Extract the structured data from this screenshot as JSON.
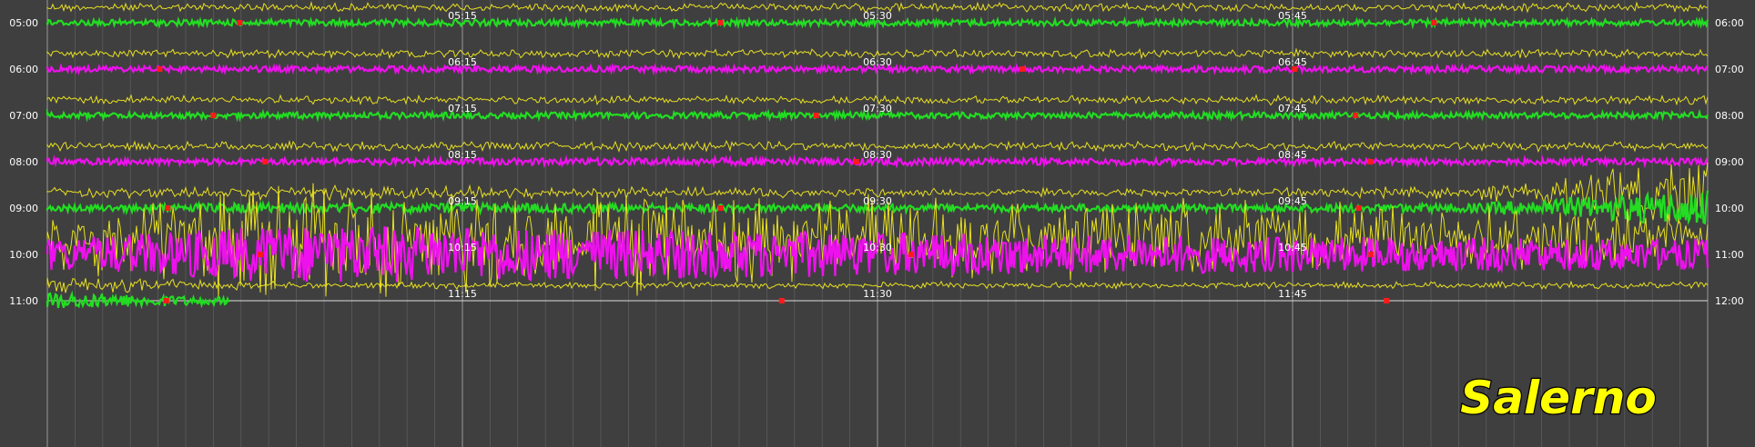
{
  "chart_data": {
    "type": "line",
    "title": "",
    "station_label": "Salerno",
    "rows": [
      {
        "left": "05:00",
        "right": "06:00",
        "color": "#22dd22",
        "ticks": [
          "05:15",
          "05:30",
          "05:45"
        ],
        "activity": [
          0.04,
          0.05,
          0.05,
          0.04,
          0.05,
          0.04,
          0.05,
          0.04
        ]
      },
      {
        "left": "06:00",
        "right": "07:00",
        "color": "#ee11ee",
        "ticks": [
          "06:15",
          "06:30",
          "06:45"
        ],
        "activity": [
          0.04,
          0.04,
          0.05,
          0.04,
          0.04,
          0.05,
          0.05,
          0.04
        ]
      },
      {
        "left": "07:00",
        "right": "08:00",
        "color": "#22dd22",
        "ticks": [
          "07:15",
          "07:30",
          "07:45"
        ],
        "activity": [
          0.04,
          0.05,
          0.04,
          0.05,
          0.04,
          0.05,
          0.04,
          0.05
        ]
      },
      {
        "left": "08:00",
        "right": "09:00",
        "color": "#ee11ee",
        "ticks": [
          "08:15",
          "08:30",
          "08:45"
        ],
        "activity": [
          0.05,
          0.05,
          0.06,
          0.08,
          0.06,
          0.05,
          0.06,
          0.05
        ]
      },
      {
        "left": "09:00",
        "right": "10:00",
        "color": "#22dd22",
        "ticks": [
          "09:15",
          "09:30",
          "09:45"
        ],
        "activity": [
          0.05,
          0.12,
          0.1,
          0.08,
          0.07,
          0.07,
          0.1,
          0.6
        ]
      },
      {
        "left": "10:00",
        "right": "11:00",
        "color": "#ee11ee",
        "ticks": [
          "10:15",
          "10:30",
          "10:45"
        ],
        "activity": [
          0.5,
          1.0,
          0.9,
          0.8,
          0.7,
          0.6,
          0.55,
          0.5
        ]
      },
      {
        "left": "11:00",
        "right": "12:00",
        "color": "#22dd22",
        "ticks": [
          "11:15",
          "11:30",
          "11:45"
        ],
        "activity": [
          0.25,
          0.0,
          0.0,
          0.0,
          0.0,
          0.0,
          0.0,
          0.0
        ]
      }
    ],
    "event_color": "#ff1a1a",
    "wave_color": "#e8e020",
    "grid": true
  }
}
